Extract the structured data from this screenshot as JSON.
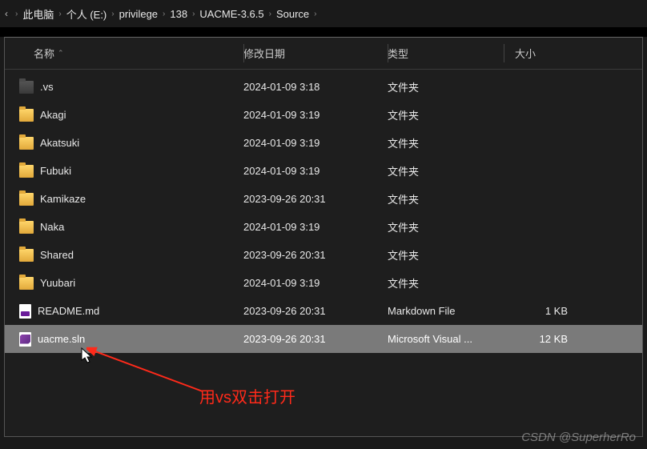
{
  "breadcrumb": {
    "items": [
      "此电脑",
      "个人 (E:)",
      "privilege",
      "138",
      "UACME-3.6.5",
      "Source"
    ]
  },
  "columns": {
    "name": "名称",
    "date": "修改日期",
    "type": "类型",
    "size": "大小"
  },
  "rows": [
    {
      "icon": "hidden",
      "name": ".vs",
      "date": "2024-01-09 3:18",
      "type": "文件夹",
      "size": ""
    },
    {
      "icon": "folder",
      "name": "Akagi",
      "date": "2024-01-09 3:19",
      "type": "文件夹",
      "size": ""
    },
    {
      "icon": "folder",
      "name": "Akatsuki",
      "date": "2024-01-09 3:19",
      "type": "文件夹",
      "size": ""
    },
    {
      "icon": "folder",
      "name": "Fubuki",
      "date": "2024-01-09 3:19",
      "type": "文件夹",
      "size": ""
    },
    {
      "icon": "folder",
      "name": "Kamikaze",
      "date": "2023-09-26 20:31",
      "type": "文件夹",
      "size": ""
    },
    {
      "icon": "folder",
      "name": "Naka",
      "date": "2024-01-09 3:19",
      "type": "文件夹",
      "size": ""
    },
    {
      "icon": "folder",
      "name": "Shared",
      "date": "2023-09-26 20:31",
      "type": "文件夹",
      "size": ""
    },
    {
      "icon": "folder",
      "name": "Yuubari",
      "date": "2024-01-09 3:19",
      "type": "文件夹",
      "size": ""
    },
    {
      "icon": "md",
      "name": "README.md",
      "date": "2023-09-26 20:31",
      "type": "Markdown File",
      "size": "1 KB"
    },
    {
      "icon": "sln",
      "name": "uacme.sln",
      "date": "2023-09-26 20:31",
      "type": "Microsoft Visual ...",
      "size": "12 KB",
      "selected": true
    }
  ],
  "annotation": "用vs双击打开",
  "watermark": "CSDN @SuperherRo"
}
